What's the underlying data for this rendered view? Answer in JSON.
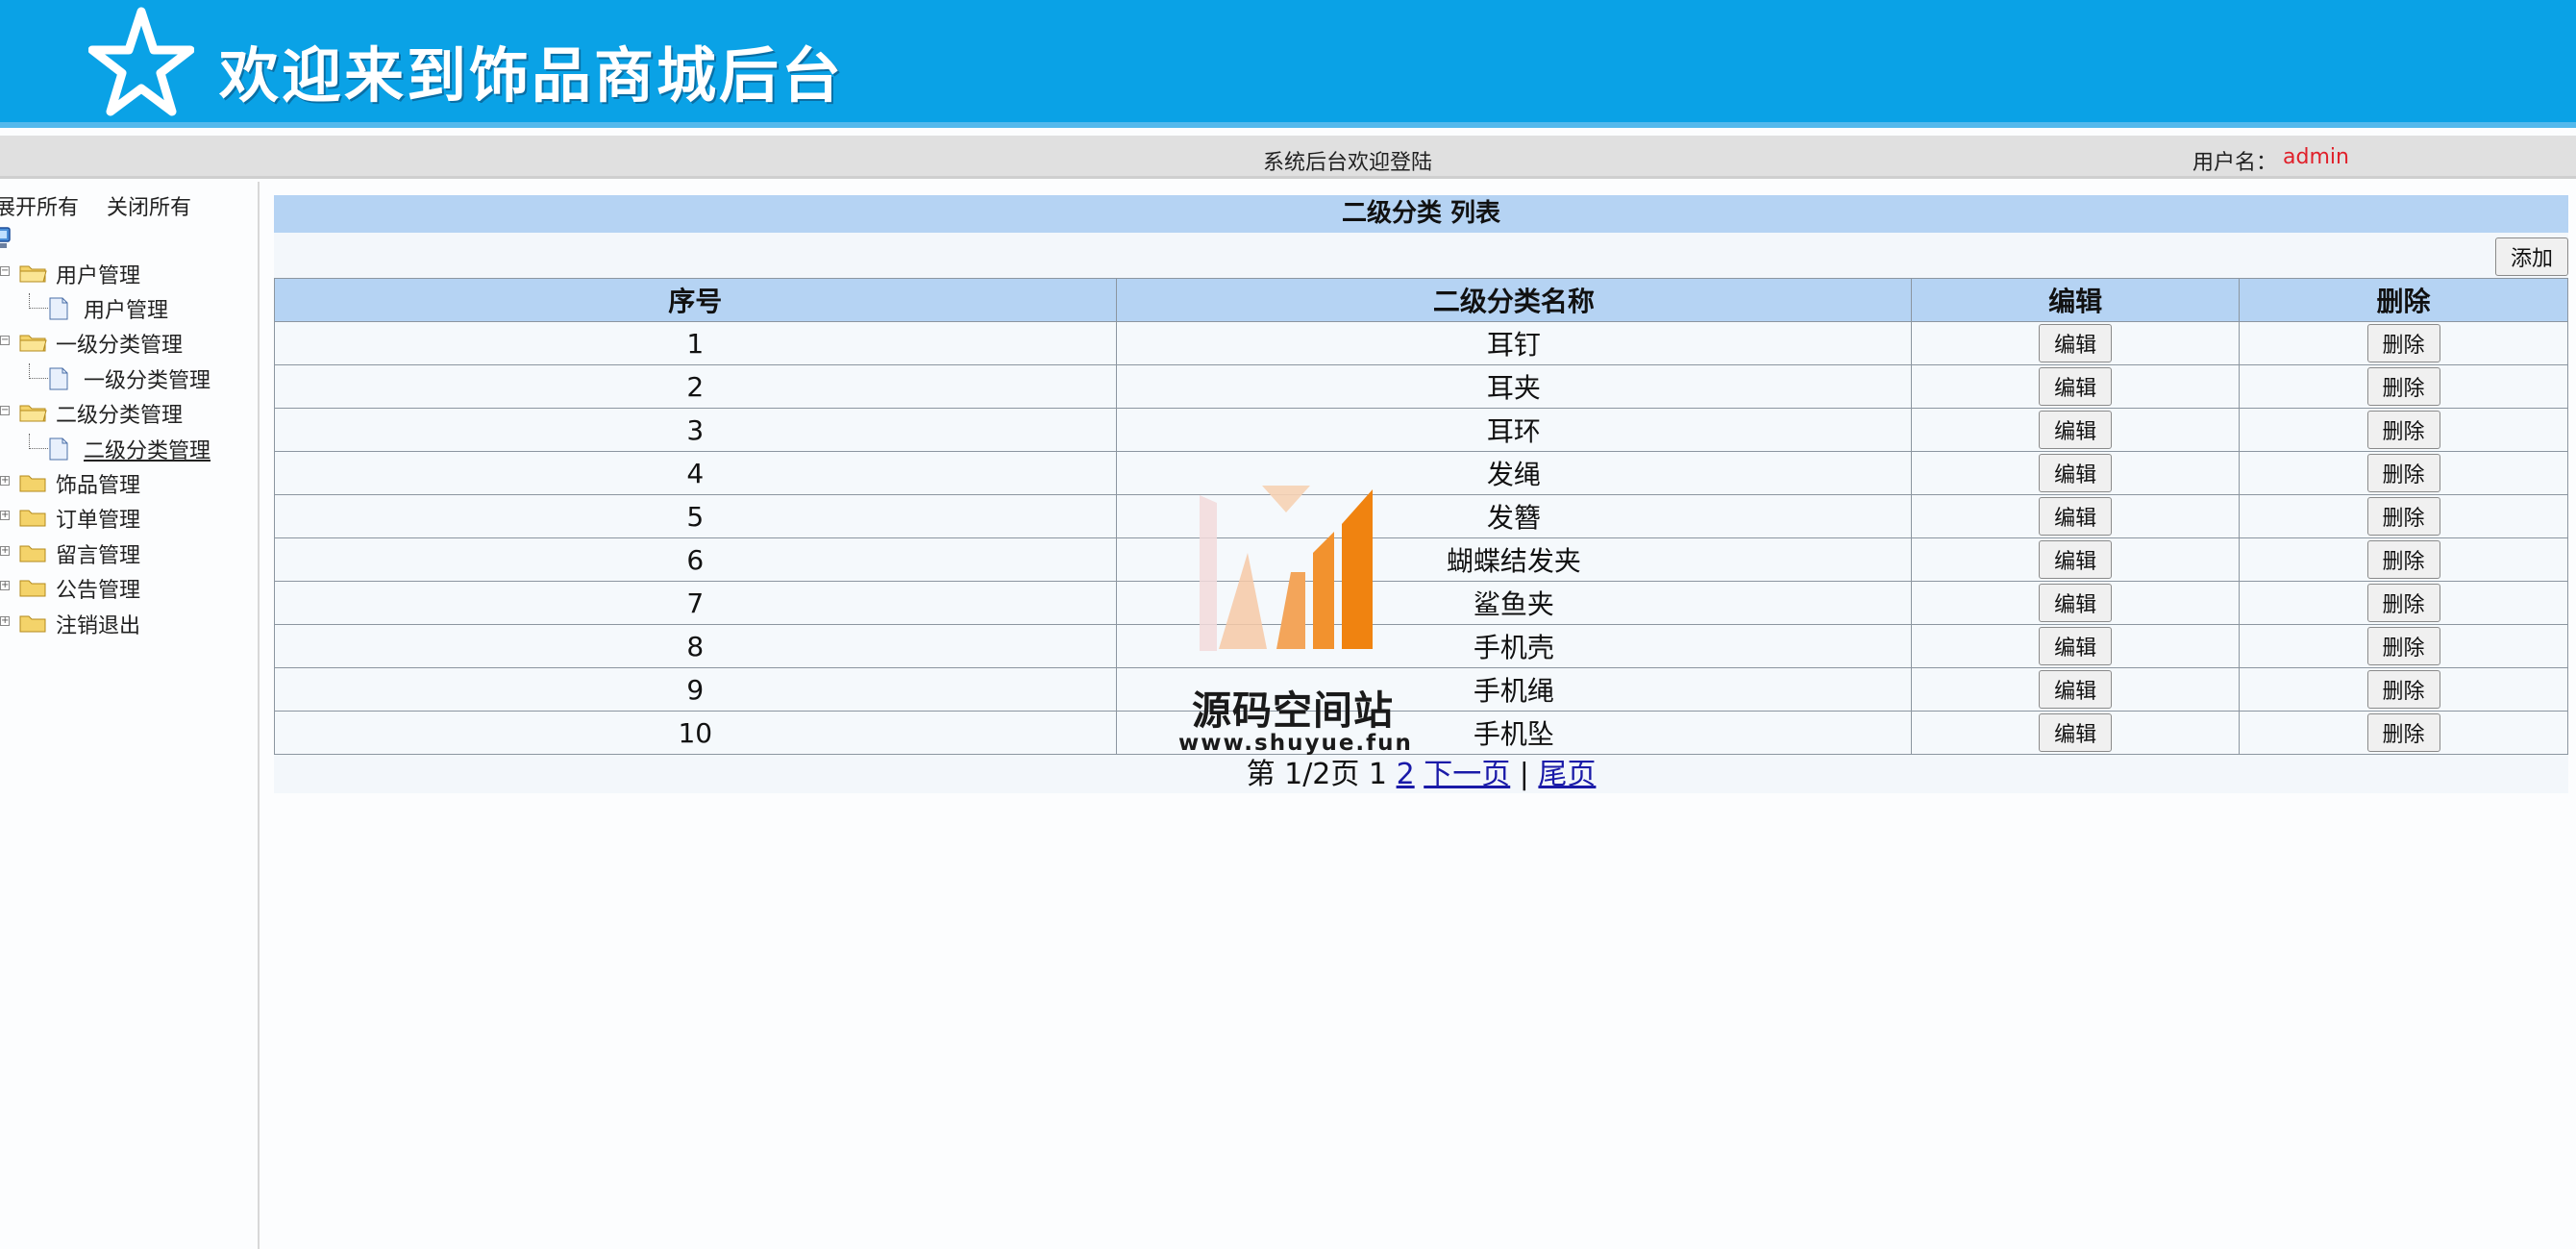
{
  "header": {
    "title": "欢迎来到饰品商城后台"
  },
  "infobar": {
    "welcome": "系统后台欢迎登陆",
    "user_label": "用户名：",
    "user_name": "admin"
  },
  "sidebar": {
    "expand_all": "展开所有",
    "collapse_all": "关闭所有",
    "tree": [
      {
        "label": "用户管理",
        "children": [
          {
            "label": "用户管理",
            "active": false
          }
        ]
      },
      {
        "label": "一级分类管理",
        "children": [
          {
            "label": "一级分类管理",
            "active": false
          }
        ]
      },
      {
        "label": "二级分类管理",
        "children": [
          {
            "label": "二级分类管理",
            "active": true
          }
        ]
      },
      {
        "label": "饰品管理",
        "children": []
      },
      {
        "label": "订单管理",
        "children": []
      },
      {
        "label": "留言管理",
        "children": []
      },
      {
        "label": "公告管理",
        "children": []
      },
      {
        "label": "注销退出",
        "children": []
      }
    ]
  },
  "main": {
    "caption": "二级分类 列表",
    "add_label": "添加",
    "columns": [
      "序号",
      "二级分类名称",
      "编辑",
      "删除"
    ],
    "edit_label": "编辑",
    "delete_label": "删除",
    "rows": [
      {
        "no": "1",
        "name": "耳钉"
      },
      {
        "no": "2",
        "name": "耳夹"
      },
      {
        "no": "3",
        "name": "耳环"
      },
      {
        "no": "4",
        "name": "发绳"
      },
      {
        "no": "5",
        "name": "发簪"
      },
      {
        "no": "6",
        "name": "蝴蝶结发夹"
      },
      {
        "no": "7",
        "name": "鲨鱼夹"
      },
      {
        "no": "8",
        "name": "手机壳"
      },
      {
        "no": "9",
        "name": "手机绳"
      },
      {
        "no": "10",
        "name": "手机坠"
      }
    ],
    "pager": {
      "status": "第 1/2页 1",
      "page_2": "2",
      "next": "下一页",
      "separator": "|",
      "last": "尾页"
    }
  },
  "watermark": {
    "text": "源码空间站",
    "url": "www.shuyue.fun"
  },
  "colors": {
    "banner": "#0aa2e6",
    "table_header": "#b5d3f3",
    "username": "#e0202a",
    "link": "#1a1aa8"
  }
}
